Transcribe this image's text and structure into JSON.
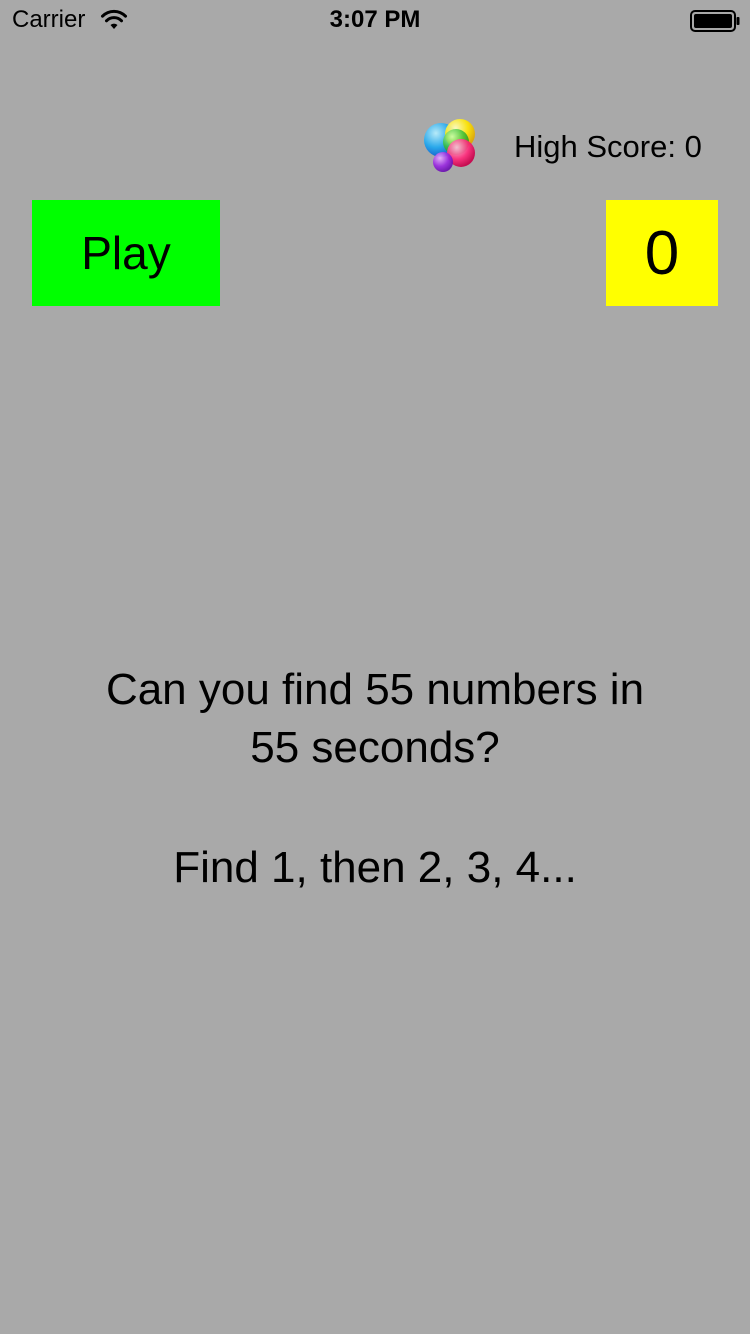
{
  "status_bar": {
    "carrier": "Carrier",
    "time": "3:07 PM",
    "wifi_icon": "wifi-icon",
    "battery_icon": "battery-full-icon"
  },
  "header": {
    "game_center_icon": "game-center-icon",
    "high_score_label": "High Score: 0"
  },
  "controls": {
    "play_label": "Play",
    "score_value": "0",
    "play_color": "#00ff00",
    "score_color": "#ffff00"
  },
  "instructions": {
    "line1": "Can you find 55 numbers in",
    "line2": "55 seconds?",
    "line3": "Find 1, then 2, 3, 4..."
  },
  "colors": {
    "background": "#a9a9a9"
  }
}
